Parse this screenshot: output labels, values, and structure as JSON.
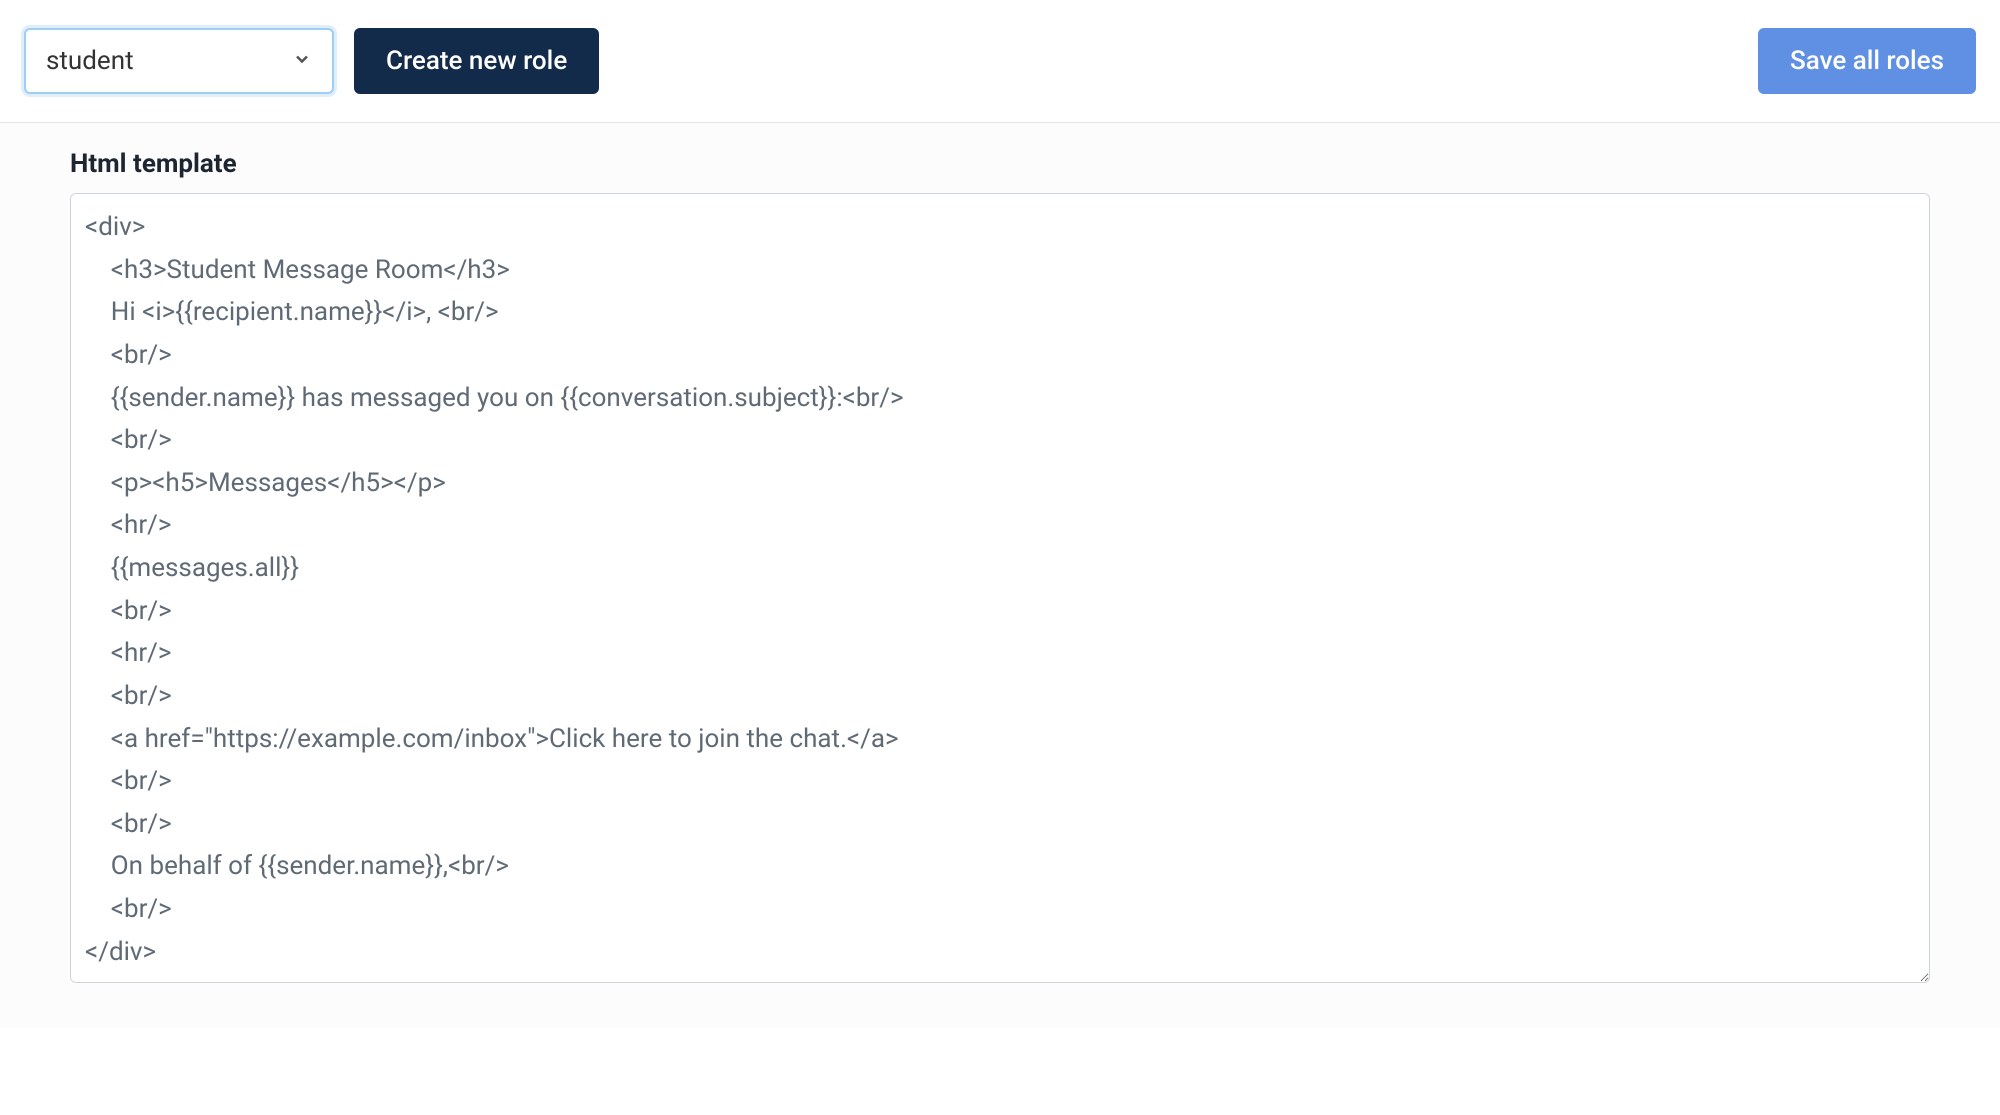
{
  "toolbar": {
    "role_select": {
      "value": "student"
    },
    "create_role_label": "Create new role",
    "save_all_label": "Save all roles"
  },
  "editor": {
    "label": "Html template",
    "value": "<div>\n    <h3>Student Message Room</h3>\n    Hi <i>{{recipient.name}}</i>, <br/>\n    <br/>\n    {{sender.name}} has messaged you on {{conversation.subject}}:<br/>\n    <br/>\n    <p><h5>Messages</h5></p>\n    <hr/>\n    {{messages.all}}\n    <br/>\n    <hr/>\n    <br/>\n    <a href=\"https://example.com/inbox\">Click here to join the chat.</a>\n    <br/>\n    <br/>\n    On behalf of {{sender.name}},<br/>\n    <br/>\n</div>"
  }
}
